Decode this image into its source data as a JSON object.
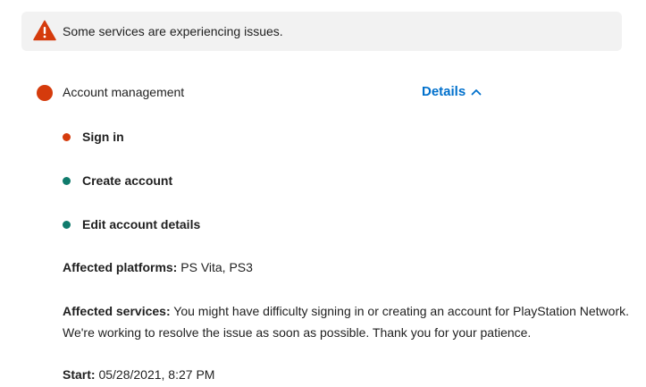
{
  "alert": {
    "message": "Some services are experiencing issues.",
    "icon": "warning-triangle-icon",
    "color": "#d53b0c"
  },
  "service": {
    "name": "Account management",
    "status_color": "#d53b0c",
    "details_label": "Details",
    "details_icon": "chevron-up-icon"
  },
  "sub_services": [
    {
      "label": "Sign in",
      "status_color": "#d53b0c"
    },
    {
      "label": "Create account",
      "status_color": "#0f7b6c"
    },
    {
      "label": "Edit account details",
      "status_color": "#0f7b6c"
    }
  ],
  "platforms": {
    "label": "Affected platforms:",
    "value": "PS Vita, PS3"
  },
  "services_info": {
    "label": "Affected services:",
    "line1": "You might have difficulty signing in or creating an account for PlayStation Network.",
    "line2": "We're working to resolve the issue as soon as possible. Thank you for your patience."
  },
  "start": {
    "label": "Start:",
    "value": "05/28/2021, 8:27 PM"
  }
}
